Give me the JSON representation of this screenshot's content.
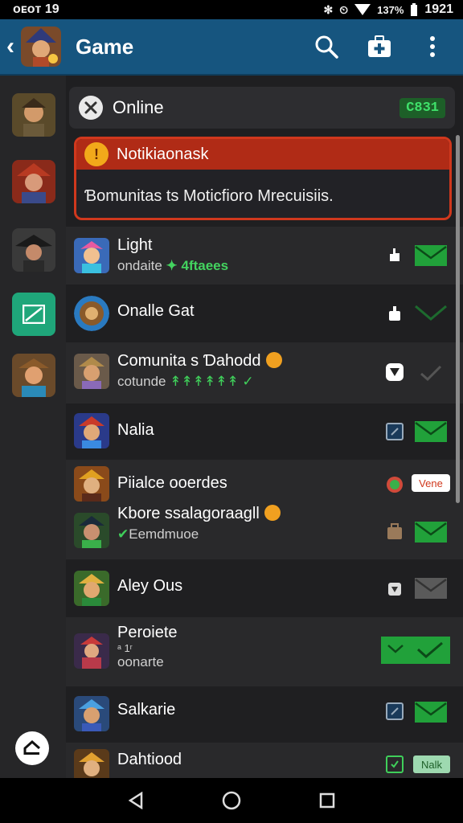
{
  "status_bar": {
    "left_text": "ᴏᴇᴏᴛ 19",
    "right_text": "137%",
    "time": "1921"
  },
  "app_bar": {
    "title": "Game",
    "icons": [
      "back-icon",
      "search-icon",
      "medkit-icon",
      "more-icon"
    ]
  },
  "online": {
    "label": "Online",
    "count": "C831"
  },
  "notice": {
    "title": "Notikiaonask",
    "body": "Ɓomunitas ts Moticfioro Mrecuisiis.",
    "icon_text": "!"
  },
  "rows": [
    {
      "title": "Light",
      "subtitle": "ondaite",
      "highlight": "✦ 4ftaees"
    },
    {
      "title": "Onalle Gat"
    },
    {
      "title": "Comunita s Ɗahodd",
      "subtitle": "cotunde",
      "highlight": "↟↟↟↟↟↟ ✓"
    },
    {
      "title": "Nalia"
    },
    {
      "title": "Piialce ooerdes",
      "badge": "Vene"
    },
    {
      "title": "Kbore ssalagoraagll",
      "subtitle": "Eemdmuoe"
    },
    {
      "title": "Aley Ous"
    },
    {
      "title": "Peroiete",
      "subtitle_top": "ᵃ 1ʳ",
      "subtitle": "oonarte"
    },
    {
      "title": "Salkarie"
    },
    {
      "title": "Dahtiood",
      "badge": "Nalk"
    }
  ],
  "colors": {
    "app_bar": "#16557f",
    "background": "#1f1f21",
    "accent_green": "#21a13a",
    "alert_red": "#d0381d"
  }
}
